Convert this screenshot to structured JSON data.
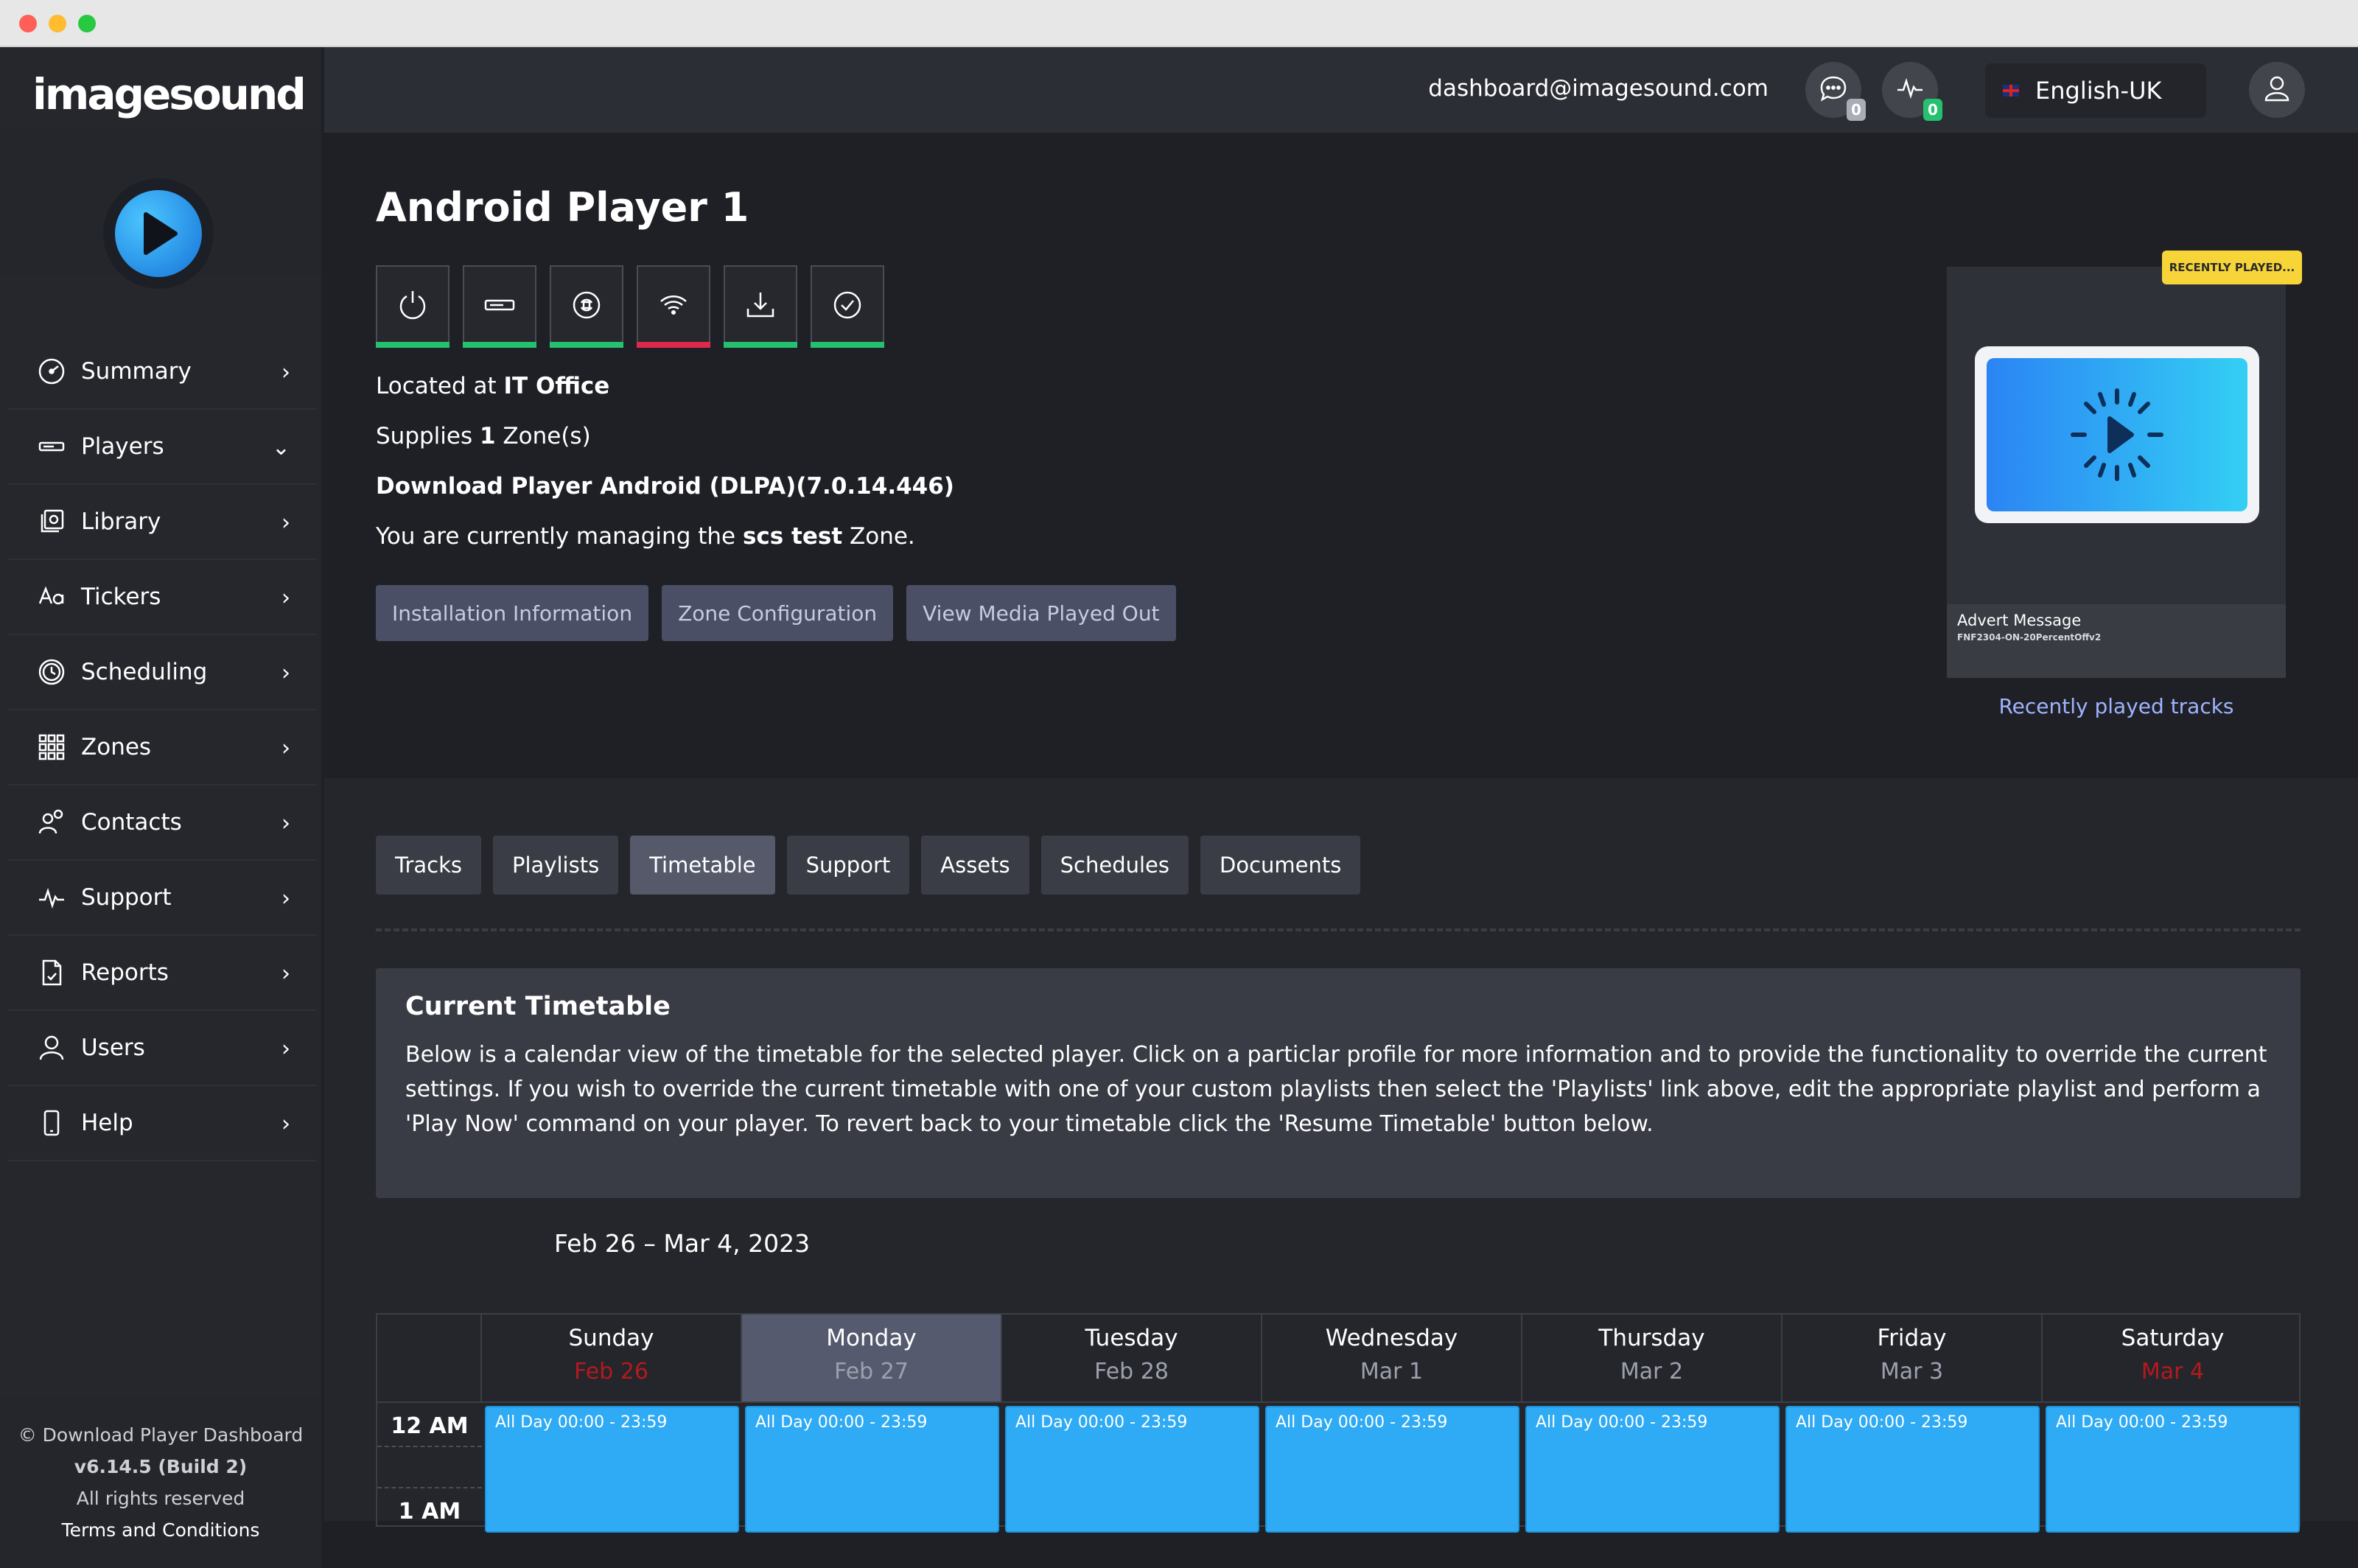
{
  "brand": {
    "name": "imagesound"
  },
  "nav": [
    {
      "label": "Summary",
      "chev": "›",
      "icon": "gauge-icon"
    },
    {
      "label": "Players",
      "chev": "⌄",
      "icon": "player-icon"
    },
    {
      "label": "Library",
      "chev": "›",
      "icon": "library-icon"
    },
    {
      "label": "Tickers",
      "chev": "›",
      "icon": "font-icon"
    },
    {
      "label": "Scheduling",
      "chev": "›",
      "icon": "clock-icon"
    },
    {
      "label": "Zones",
      "chev": "›",
      "icon": "grid-icon"
    },
    {
      "label": "Contacts",
      "chev": "›",
      "icon": "contacts-icon"
    },
    {
      "label": "Support",
      "chev": "›",
      "icon": "pulse-icon"
    },
    {
      "label": "Reports",
      "chev": "›",
      "icon": "report-icon"
    },
    {
      "label": "Users",
      "chev": "›",
      "icon": "user-icon"
    },
    {
      "label": "Help",
      "chev": "›",
      "icon": "phone-icon"
    }
  ],
  "footer": {
    "line1": "© Download Player Dashboard",
    "version": "v6.14.5 (Build 2)",
    "rights": "All rights reserved",
    "terms": "Terms and Conditions"
  },
  "topbar": {
    "email": "dashboard@imagesound.com",
    "messages_count": "0",
    "activity_count": "0",
    "language": "English-UK"
  },
  "player": {
    "title": "Android Player 1",
    "located_prefix": "Located at ",
    "location": "IT Office",
    "supplies_prefix": "Supplies ",
    "zones_count": "1",
    "supplies_suffix": " Zone(s)",
    "software": "Download Player Android (DLPA)(7.0.14.446)",
    "managing_prefix": "You are currently managing the ",
    "zone_name": "scs test",
    "managing_suffix": " Zone."
  },
  "status_colors": {
    "green": "#25c16f",
    "red": "#e0294a"
  },
  "actions": {
    "install": "Installation Information",
    "zone_config": "Zone Configuration",
    "media": "View Media Played Out"
  },
  "recently_played": {
    "tag": "RECENTLY PLAYED...",
    "title": "Advert Message",
    "file": "FNF2304-ON-20PercentOffv2",
    "link": "Recently played tracks"
  },
  "tabs": [
    "Tracks",
    "Playlists",
    "Timetable",
    "Support",
    "Assets",
    "Schedules",
    "Documents"
  ],
  "timetable": {
    "title": "Current Timetable",
    "description": "Below is a calendar view of the timetable for the selected player. Click on a particlar profile for more information and to provide the functionality to override the current settings. If you wish to override the current timetable with one of your custom playlists then select the 'Playlists' link above, edit the appropriate playlist and perform a 'Play Now' command on your player. To revert back to your timetable click the 'Resume Timetable' button below.",
    "week": "Feb 26 – Mar 4, 2023",
    "days": [
      {
        "name": "Sunday",
        "date": "Feb 26"
      },
      {
        "name": "Monday",
        "date": "Feb 27"
      },
      {
        "name": "Tuesday",
        "date": "Feb 28"
      },
      {
        "name": "Wednesday",
        "date": "Mar 1"
      },
      {
        "name": "Thursday",
        "date": "Mar 2"
      },
      {
        "name": "Friday",
        "date": "Mar 3"
      },
      {
        "name": "Saturday",
        "date": "Mar 4"
      }
    ],
    "hours": [
      "12 AM",
      "1 AM"
    ],
    "event": "All Day 00:00 - 23:59"
  }
}
